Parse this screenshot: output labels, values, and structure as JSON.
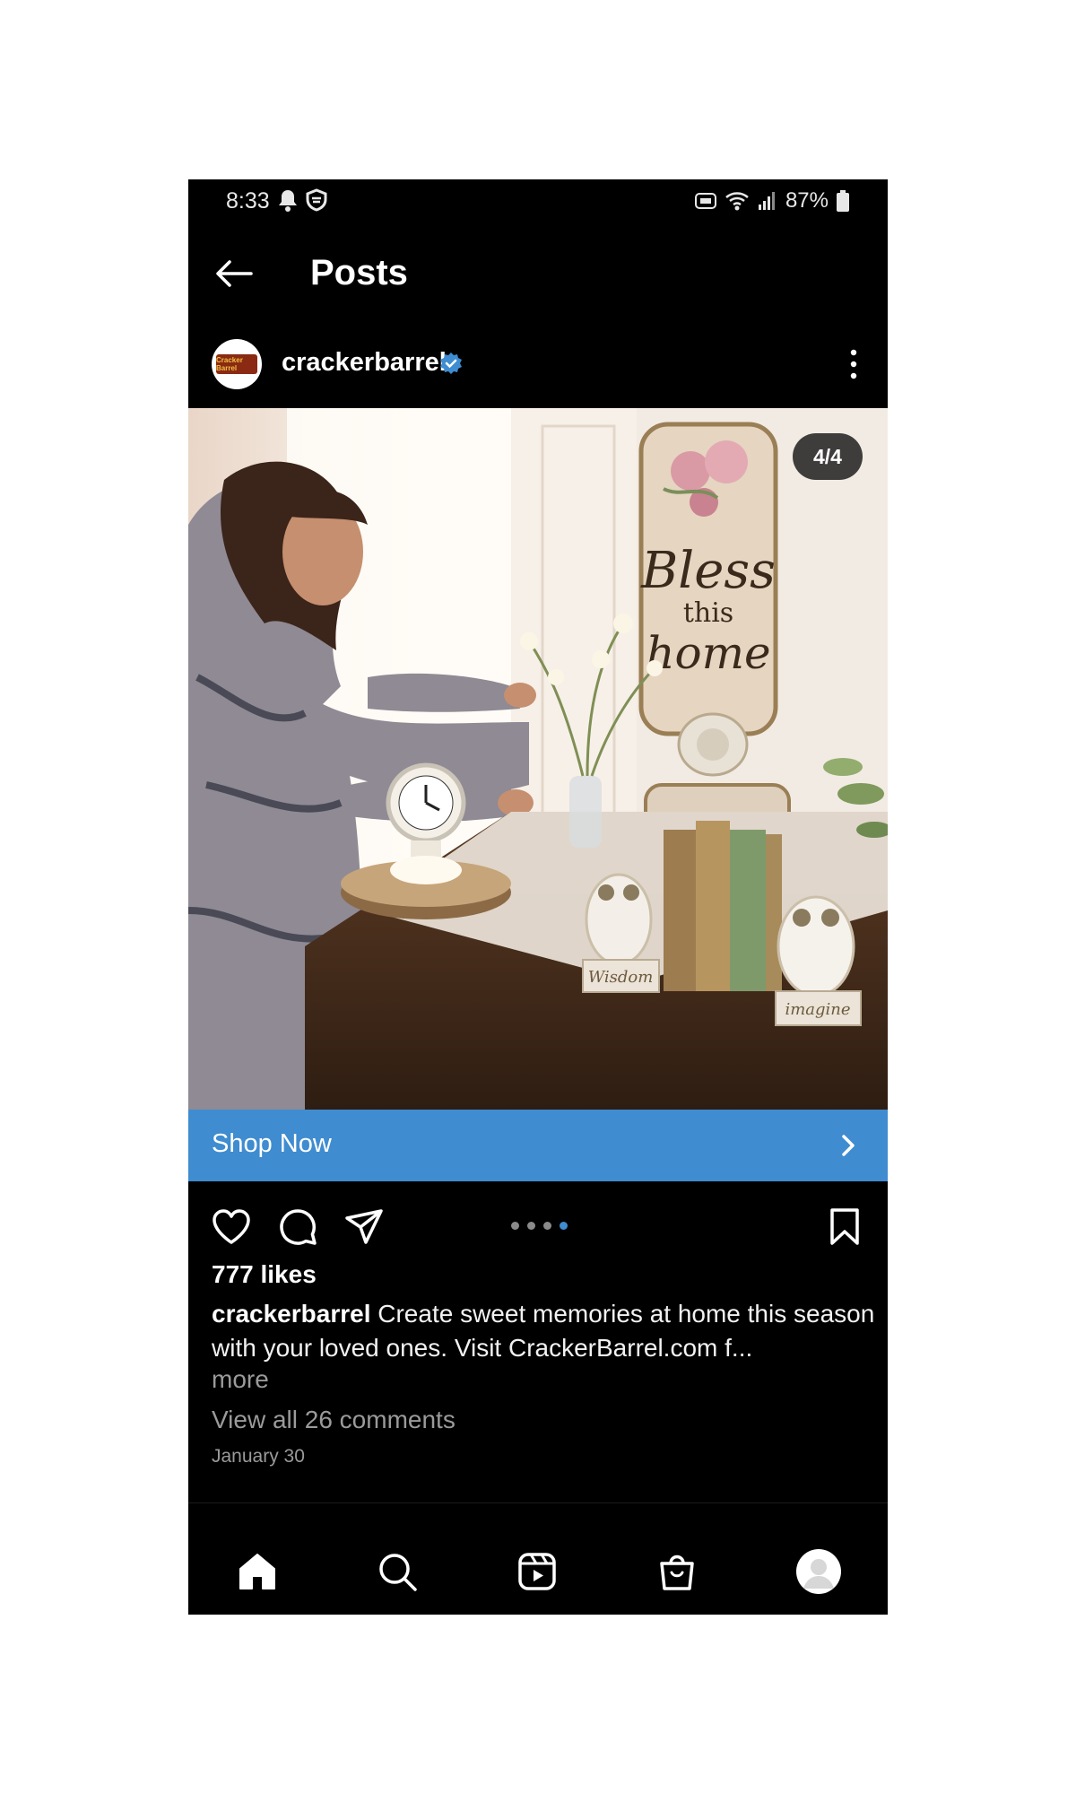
{
  "status_bar": {
    "time": "8:33",
    "battery": "87%",
    "left_icons": [
      "bell-icon",
      "shield-icon"
    ],
    "right_icons": [
      "volte-icon",
      "wifi-icon",
      "signal-icon",
      "battery-icon"
    ]
  },
  "header": {
    "title": "Posts"
  },
  "post": {
    "username": "crackerbarrel",
    "verified": true,
    "avatar_text": "Cracker Barrel",
    "image_counter": "4/4",
    "image_sign_text": [
      "Bless",
      "this",
      "home"
    ],
    "image_book_labels": [
      "Wisdom",
      "imagine"
    ],
    "shop_label": "Shop Now",
    "likes": "777 likes",
    "caption_user": "crackerbarrel",
    "caption_text": "Create sweet memories at home this season with your loved ones.  Visit CrackerBarrel.com f...",
    "more_label": "more",
    "comments_label": "View all 26 comments",
    "date": "January 30",
    "carousel": {
      "count": 4,
      "active": 4
    }
  },
  "colors": {
    "accent": "#3f8cd0",
    "background": "#000000",
    "muted_text": "#9a9a9a"
  },
  "bottom_nav": {
    "items": [
      "home-icon",
      "search-icon",
      "reels-icon",
      "shop-icon",
      "profile-avatar"
    ]
  }
}
